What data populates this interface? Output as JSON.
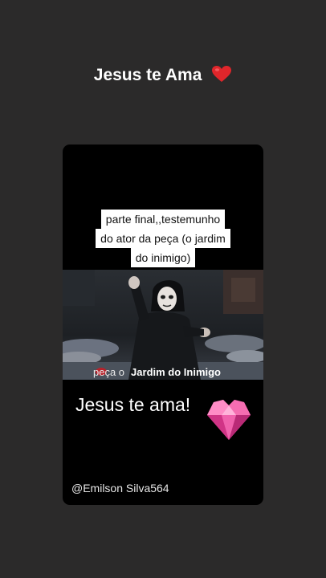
{
  "header": {
    "title": "Jesus te Ama",
    "title_icon": "red-heart-emoji"
  },
  "video": {
    "caption_lines": [
      "parte final,,testemunho",
      "do ator da peça (o jardim",
      "do inimigo)"
    ],
    "frame_text_prefix": "peça o",
    "frame_text_bold": "Jardim do Inimigo",
    "overlay_text": "Jesus te ama!",
    "overlay_icon": "pink-gem-heart",
    "author": "@Emilson Silva564"
  },
  "colors": {
    "background": "#2b2a2a",
    "card": "#000000",
    "heart": "#e0262b",
    "gem": "#f05aa8"
  }
}
